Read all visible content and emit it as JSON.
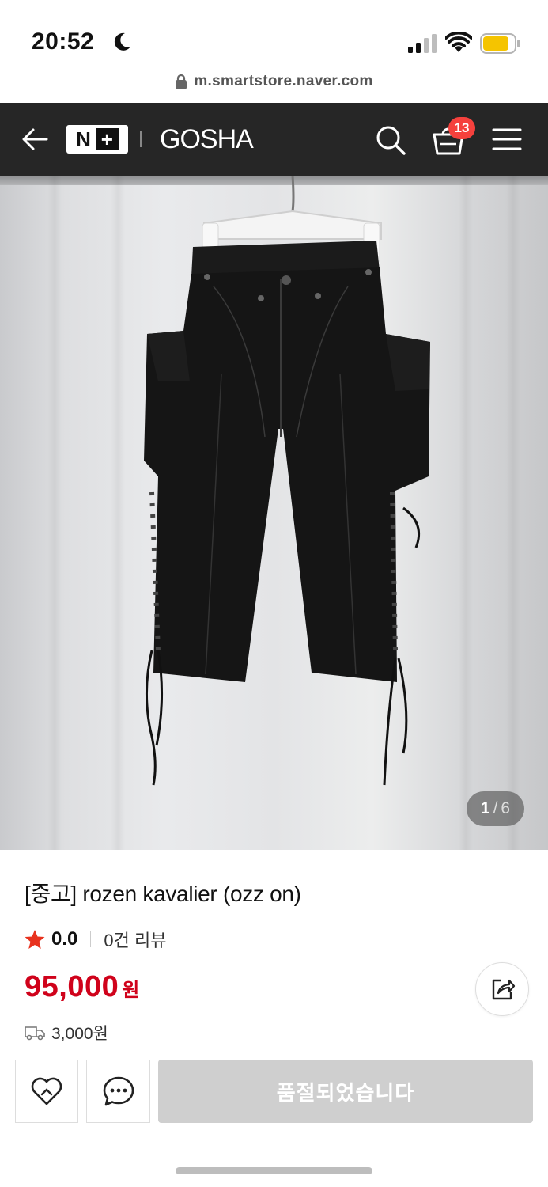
{
  "status_bar": {
    "time": "20:52",
    "icons": [
      "moon-icon",
      "signal-icon",
      "wifi-icon",
      "battery-icon"
    ],
    "battery_color": "#f5c400"
  },
  "browser": {
    "url": "m.smartstore.naver.com",
    "icon": "lock-icon"
  },
  "header": {
    "logo_letter": "N",
    "logo_plus": "+",
    "store_name": "GOSHA",
    "cart_count": "13",
    "icons": [
      "back-arrow-icon",
      "search-icon",
      "cart-icon",
      "menu-icon"
    ],
    "background": "#262626",
    "badge_color": "#f5413d"
  },
  "gallery": {
    "current": "1",
    "separator": "/",
    "total": "6"
  },
  "product": {
    "title": "[중고] rozen kavalier (ozz on)",
    "rating": "0.0",
    "review_count": "0건 리뷰",
    "price": "95,000",
    "currency": "원",
    "shipping_fee": "3,000원",
    "price_color": "#d0021b",
    "star_color": "#e8321e"
  },
  "actions": {
    "sold_out_label": "품절되었습니다",
    "icons": [
      "heart-icon",
      "chat-icon",
      "share-icon"
    ]
  }
}
